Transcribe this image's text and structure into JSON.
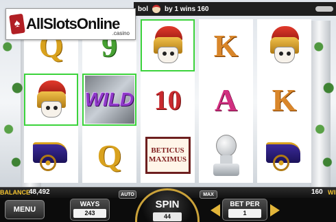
{
  "branding": {
    "logo_text": "AllSlotsOnline",
    "logo_subtext": ".casino"
  },
  "info_bar": {
    "text": "bol",
    "message": "by 1 wins 160"
  },
  "reels": [
    [
      {
        "symbol": "Q",
        "win": false
      },
      {
        "symbol": "centurion",
        "win": true
      },
      {
        "symbol": "chariot",
        "win": false
      }
    ],
    [
      {
        "symbol": "9",
        "win": false
      },
      {
        "symbol": "WILD",
        "win": true
      },
      {
        "symbol": "Q",
        "win": false
      }
    ],
    [
      {
        "symbol": "centurion",
        "win": true
      },
      {
        "symbol": "10",
        "win": false
      },
      {
        "symbol": "BETICUS MAXIMUS",
        "win": false
      }
    ],
    [
      {
        "symbol": "K",
        "win": false
      },
      {
        "symbol": "A",
        "win": false
      },
      {
        "symbol": "bust",
        "win": false
      }
    ],
    [
      {
        "symbol": "centurion",
        "win": false
      },
      {
        "symbol": "K",
        "win": false
      },
      {
        "symbol": "chariot",
        "win": false
      }
    ]
  ],
  "tablet": {
    "line1": "BETICUS",
    "line2": "MAXIMUS"
  },
  "wild_label": "WILD",
  "hud": {
    "balance_label": "BALANCE",
    "balance_value": "48,492",
    "win_value": "160",
    "win_label": "WIN",
    "menu_label": "MENU",
    "ways_label": "WAYS",
    "ways_value": "243",
    "auto_label": "AUTO",
    "max_label": "MAX",
    "spin_label": "SPIN",
    "spin_value": "44",
    "bet_per_label": "BET PER",
    "bet_per_value": "1"
  },
  "colors": {
    "win_highlight": "#3bd33b",
    "gold": "#e2b53a",
    "hud_bg": "#0c0c0c"
  }
}
